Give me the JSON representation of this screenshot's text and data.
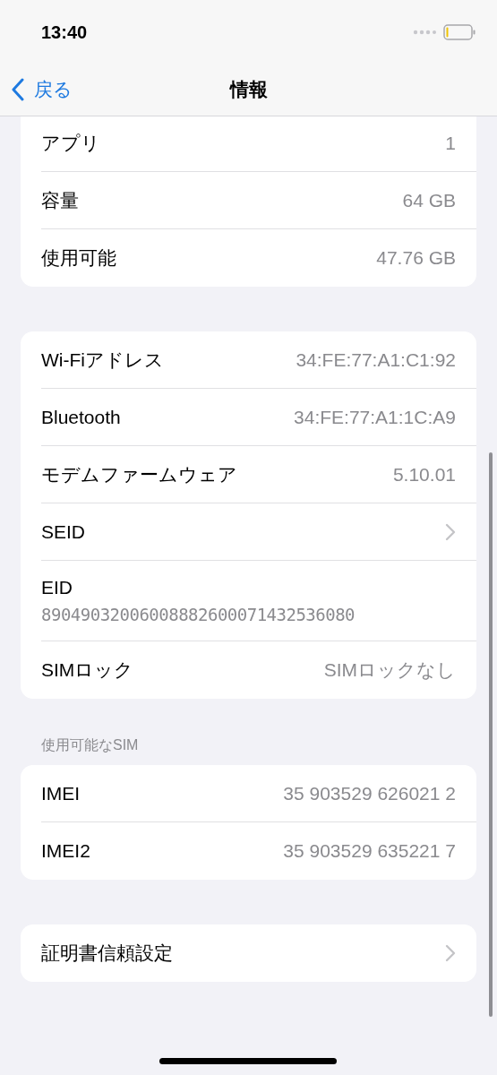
{
  "status_bar": {
    "time": "13:40"
  },
  "nav": {
    "back": "戻る",
    "title": "情報"
  },
  "sections": [
    {
      "rows": [
        {
          "kind": "value",
          "label": "アプリ",
          "value": "1"
        },
        {
          "kind": "value",
          "label": "容量",
          "value": "64 GB"
        },
        {
          "kind": "value",
          "label": "使用可能",
          "value": "47.76 GB"
        }
      ]
    },
    {
      "rows": [
        {
          "kind": "value",
          "label": "Wi-Fiアドレス",
          "value": "34:FE:77:A1:C1:92"
        },
        {
          "kind": "value",
          "label": "Bluetooth",
          "value": "34:FE:77:A1:1C:A9"
        },
        {
          "kind": "value",
          "label": "モデムファームウェア",
          "value": "5.10.01"
        },
        {
          "kind": "chevron",
          "label": "SEID"
        },
        {
          "kind": "stacked",
          "label": "EID",
          "value": "89049032006008882600071432536080"
        },
        {
          "kind": "value",
          "label": "SIMロック",
          "value": "SIMロックなし"
        }
      ]
    },
    {
      "header": "使用可能なSIM",
      "rows": [
        {
          "kind": "value",
          "label": "IMEI",
          "value": "35 903529 626021 2"
        },
        {
          "kind": "value",
          "label": "IMEI2",
          "value": "35 903529 635221 7"
        }
      ]
    },
    {
      "rows": [
        {
          "kind": "chevron",
          "label": "証明書信頼設定"
        }
      ]
    }
  ]
}
